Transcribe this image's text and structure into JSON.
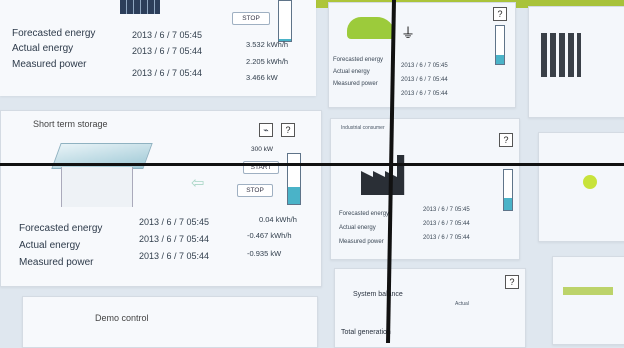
{
  "top_left": {
    "stop_label": "STOP",
    "rows": [
      {
        "label": "Forecasted energy",
        "date": "2013 / 6 / 7  05:45",
        "value": "3.532 kWh/h"
      },
      {
        "label": "Actual energy",
        "date": "2013 / 6 / 7  05:44",
        "value": "2.205 kWh/h"
      },
      {
        "label": "Measured power",
        "date": "2013 / 6 / 7  05:44",
        "value": "3.466 kW"
      }
    ],
    "tank_level": 0.05
  },
  "storage": {
    "title": "Short term storage",
    "power_label": "300 kW",
    "start_label": "START",
    "stop_label": "STOP",
    "help": "?",
    "tank_level": 0.35,
    "rows": [
      {
        "label": "Forecasted energy",
        "date": "2013 / 6 / 7  05:45",
        "value": "0.04 kWh/h"
      },
      {
        "label": "Actual energy",
        "date": "2013 / 6 / 7  05:44",
        "value": "-0.467 kWh/h"
      },
      {
        "label": "Measured power",
        "date": "2013 / 6 / 7  05:44",
        "value": "-0.935 kW"
      }
    ]
  },
  "demo": {
    "title": "Demo control"
  },
  "ev": {
    "help": "?",
    "rows": [
      {
        "label": "Forecasted energy",
        "date": "2013 / 6 / 7  05:45"
      },
      {
        "label": "Actual energy",
        "date": "2013 / 6 / 7  05:44"
      },
      {
        "label": "Measured power",
        "date": "2013 / 6 / 7  05:44"
      }
    ],
    "tank_level": 0.25
  },
  "industrial": {
    "title": "Industrial consumer",
    "help": "?",
    "tank_level": 0.3,
    "rows": [
      {
        "label": "Forecasted energy",
        "date": "2013 / 6 / 7  05:45"
      },
      {
        "label": "Actual energy",
        "date": "2013 / 6 / 7  05:44"
      },
      {
        "label": "Measured power",
        "date": "2013 / 6 / 7  05:44"
      }
    ]
  },
  "balance": {
    "title": "System balance",
    "col_actual": "Actual",
    "total_label": "Total generation",
    "help": "?"
  },
  "colors": {
    "accent_green": "#a7c23a",
    "tank_blue": "#4ab3c8"
  }
}
